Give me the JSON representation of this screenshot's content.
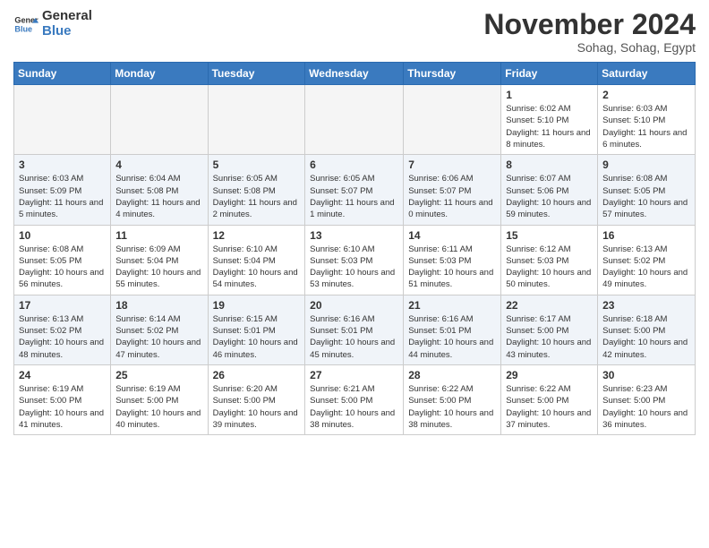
{
  "header": {
    "logo_general": "General",
    "logo_blue": "Blue",
    "month_title": "November 2024",
    "location": "Sohag, Sohag, Egypt"
  },
  "weekdays": [
    "Sunday",
    "Monday",
    "Tuesday",
    "Wednesday",
    "Thursday",
    "Friday",
    "Saturday"
  ],
  "weeks": [
    [
      {
        "day": "",
        "info": ""
      },
      {
        "day": "",
        "info": ""
      },
      {
        "day": "",
        "info": ""
      },
      {
        "day": "",
        "info": ""
      },
      {
        "day": "",
        "info": ""
      },
      {
        "day": "1",
        "info": "Sunrise: 6:02 AM\nSunset: 5:10 PM\nDaylight: 11 hours and 8 minutes."
      },
      {
        "day": "2",
        "info": "Sunrise: 6:03 AM\nSunset: 5:10 PM\nDaylight: 11 hours and 6 minutes."
      }
    ],
    [
      {
        "day": "3",
        "info": "Sunrise: 6:03 AM\nSunset: 5:09 PM\nDaylight: 11 hours and 5 minutes."
      },
      {
        "day": "4",
        "info": "Sunrise: 6:04 AM\nSunset: 5:08 PM\nDaylight: 11 hours and 4 minutes."
      },
      {
        "day": "5",
        "info": "Sunrise: 6:05 AM\nSunset: 5:08 PM\nDaylight: 11 hours and 2 minutes."
      },
      {
        "day": "6",
        "info": "Sunrise: 6:05 AM\nSunset: 5:07 PM\nDaylight: 11 hours and 1 minute."
      },
      {
        "day": "7",
        "info": "Sunrise: 6:06 AM\nSunset: 5:07 PM\nDaylight: 11 hours and 0 minutes."
      },
      {
        "day": "8",
        "info": "Sunrise: 6:07 AM\nSunset: 5:06 PM\nDaylight: 10 hours and 59 minutes."
      },
      {
        "day": "9",
        "info": "Sunrise: 6:08 AM\nSunset: 5:05 PM\nDaylight: 10 hours and 57 minutes."
      }
    ],
    [
      {
        "day": "10",
        "info": "Sunrise: 6:08 AM\nSunset: 5:05 PM\nDaylight: 10 hours and 56 minutes."
      },
      {
        "day": "11",
        "info": "Sunrise: 6:09 AM\nSunset: 5:04 PM\nDaylight: 10 hours and 55 minutes."
      },
      {
        "day": "12",
        "info": "Sunrise: 6:10 AM\nSunset: 5:04 PM\nDaylight: 10 hours and 54 minutes."
      },
      {
        "day": "13",
        "info": "Sunrise: 6:10 AM\nSunset: 5:03 PM\nDaylight: 10 hours and 53 minutes."
      },
      {
        "day": "14",
        "info": "Sunrise: 6:11 AM\nSunset: 5:03 PM\nDaylight: 10 hours and 51 minutes."
      },
      {
        "day": "15",
        "info": "Sunrise: 6:12 AM\nSunset: 5:03 PM\nDaylight: 10 hours and 50 minutes."
      },
      {
        "day": "16",
        "info": "Sunrise: 6:13 AM\nSunset: 5:02 PM\nDaylight: 10 hours and 49 minutes."
      }
    ],
    [
      {
        "day": "17",
        "info": "Sunrise: 6:13 AM\nSunset: 5:02 PM\nDaylight: 10 hours and 48 minutes."
      },
      {
        "day": "18",
        "info": "Sunrise: 6:14 AM\nSunset: 5:02 PM\nDaylight: 10 hours and 47 minutes."
      },
      {
        "day": "19",
        "info": "Sunrise: 6:15 AM\nSunset: 5:01 PM\nDaylight: 10 hours and 46 minutes."
      },
      {
        "day": "20",
        "info": "Sunrise: 6:16 AM\nSunset: 5:01 PM\nDaylight: 10 hours and 45 minutes."
      },
      {
        "day": "21",
        "info": "Sunrise: 6:16 AM\nSunset: 5:01 PM\nDaylight: 10 hours and 44 minutes."
      },
      {
        "day": "22",
        "info": "Sunrise: 6:17 AM\nSunset: 5:00 PM\nDaylight: 10 hours and 43 minutes."
      },
      {
        "day": "23",
        "info": "Sunrise: 6:18 AM\nSunset: 5:00 PM\nDaylight: 10 hours and 42 minutes."
      }
    ],
    [
      {
        "day": "24",
        "info": "Sunrise: 6:19 AM\nSunset: 5:00 PM\nDaylight: 10 hours and 41 minutes."
      },
      {
        "day": "25",
        "info": "Sunrise: 6:19 AM\nSunset: 5:00 PM\nDaylight: 10 hours and 40 minutes."
      },
      {
        "day": "26",
        "info": "Sunrise: 6:20 AM\nSunset: 5:00 PM\nDaylight: 10 hours and 39 minutes."
      },
      {
        "day": "27",
        "info": "Sunrise: 6:21 AM\nSunset: 5:00 PM\nDaylight: 10 hours and 38 minutes."
      },
      {
        "day": "28",
        "info": "Sunrise: 6:22 AM\nSunset: 5:00 PM\nDaylight: 10 hours and 38 minutes."
      },
      {
        "day": "29",
        "info": "Sunrise: 6:22 AM\nSunset: 5:00 PM\nDaylight: 10 hours and 37 minutes."
      },
      {
        "day": "30",
        "info": "Sunrise: 6:23 AM\nSunset: 5:00 PM\nDaylight: 10 hours and 36 minutes."
      }
    ]
  ]
}
